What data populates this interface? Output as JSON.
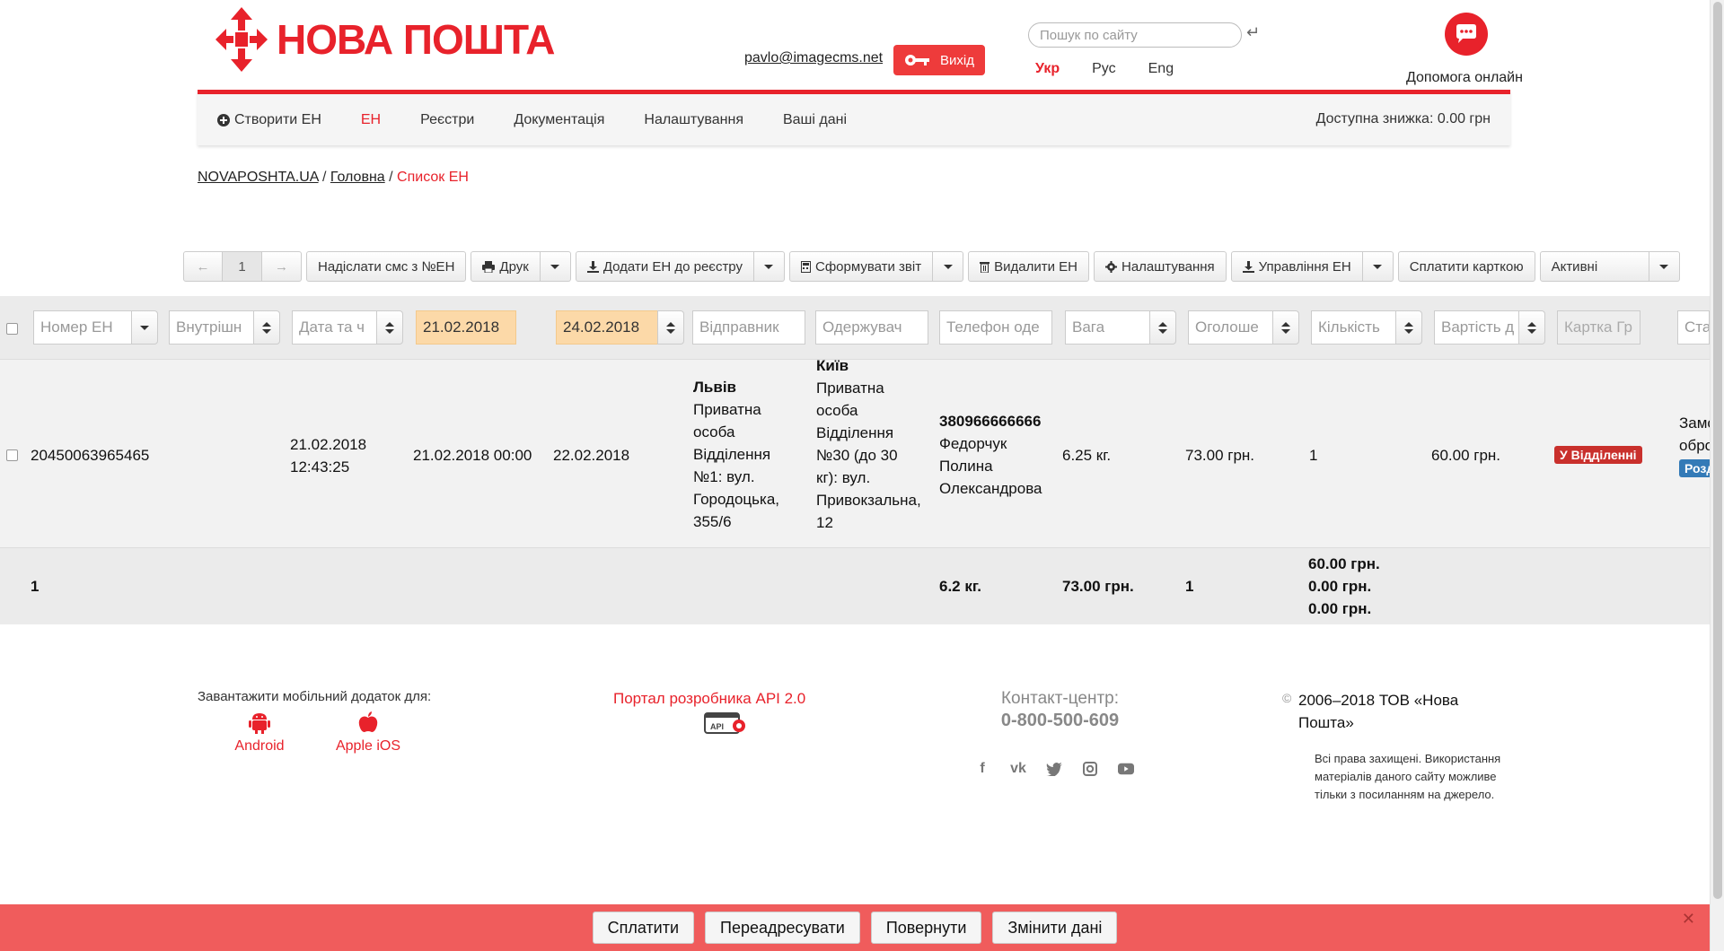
{
  "header": {
    "logo_text": "НОВА ПОШТА",
    "user_email": "pavlo@imagecms.net",
    "logout_label": "Вихід",
    "search_placeholder": "Пошук по сайту",
    "languages": [
      "Укр",
      "Рус",
      "Eng"
    ],
    "active_language": "Укр",
    "help_label": "Допомога онлайн"
  },
  "nav": {
    "items": [
      "Створити ЕН",
      "ЕН",
      "Реєстри",
      "Документація",
      "Налаштування",
      "Ваші дані"
    ],
    "active": "ЕН",
    "discount": "Доступна знижка: 0.00 грн"
  },
  "breadcrumb": {
    "items": [
      "NOVAPOSHTA.UA",
      "Головна"
    ],
    "current": "Список ЕН"
  },
  "toolbar": {
    "page": "1",
    "send_sms": "Надіслати смс з №ЕН",
    "print": "Друк",
    "add_to_register": "Додати ЕН до реєстру",
    "make_report": "Сформувати звіт",
    "delete": "Видалити ЕН",
    "settings": "Налаштування",
    "manage": "Управління ЕН",
    "pay_card": "Сплатити карткою",
    "status_filter": "Активні"
  },
  "filters": {
    "number": "Номер ЕН",
    "internal": "Внутрішн",
    "datetime": "Дата та ч",
    "date_from": "21.02.2018",
    "date_to": "24.02.2018",
    "sender": "Відправник",
    "recipient": "Одержувач",
    "phone": "Телефон оде",
    "weight": "Вага",
    "declared": "Оголоше",
    "quantity": "Кількість",
    "cost": "Вартість д",
    "card": "Картка Гр",
    "status": "Ста"
  },
  "rows": [
    {
      "number": "20450063965465",
      "created": [
        "21.02.2018",
        "12:43:25"
      ],
      "send_date": "21.02.2018 00:00",
      "delivery_date": "22.02.2018",
      "sender_city": "Львів",
      "sender_lines": [
        "Приватна",
        "особа",
        "Відділення",
        "№1: вул.",
        "Городоцька,",
        "355/6"
      ],
      "recipient_city": "Київ",
      "recipient_lines": [
        "Приватна",
        "особа",
        "Відділення",
        "№30 (до 30",
        "кг): вул.",
        "Привокзальна,",
        "12"
      ],
      "phone": "380966666666",
      "recipient_name": [
        "Федорчук",
        "Полина",
        "Олександрова"
      ],
      "weight": "6.25 кг.",
      "declared": "73.00 грн.",
      "quantity": "1",
      "cost": "60.00 грн.",
      "status_badge": "У Відділенні",
      "extra_lines": [
        "Замо",
        "обро"
      ],
      "extra_badge": "Розд"
    }
  ],
  "totals": {
    "count": "1",
    "weight": "6.2 кг.",
    "declared": "73.00 грн.",
    "quantity": "1",
    "sums": [
      "60.00 грн.",
      "0.00 грн.",
      "0.00 грн."
    ]
  },
  "footer": {
    "mobile_label": "Завантажити мобільний додаток для:",
    "android": "Android",
    "ios": "Apple iOS",
    "api_portal": "Портал розробника API 2.0",
    "contact_label": "Контакт-центр:",
    "contact_phone": "0-800-500-609",
    "copyright_sign": "©",
    "copyright": "2006–2018 ТОВ «Нова Пошта»",
    "rights": "Всі права захищені. Використання матеріалів даного сайту можливе тільки з посиланням на джерело."
  },
  "action_bar": {
    "buttons": [
      "Сплатити",
      "Переадресувати",
      "Повернути",
      "Змінити дані"
    ],
    "close": "✕"
  },
  "colors": {
    "brand_red": "#e8222b",
    "action_bar": "#f05c5c",
    "date_filter": "#fcd9a8",
    "status_red": "#c9302c",
    "status_blue": "#337ab7"
  }
}
